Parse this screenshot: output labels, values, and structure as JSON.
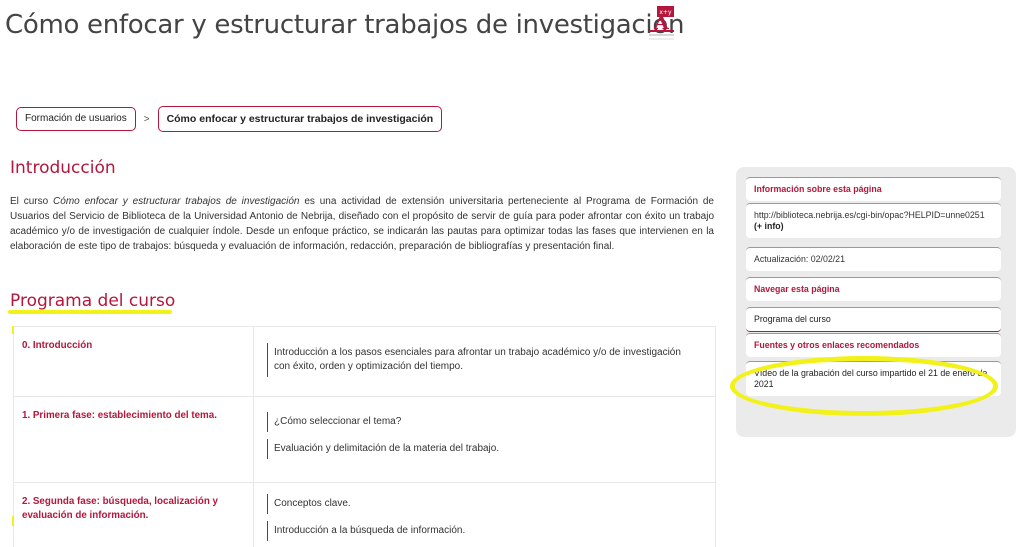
{
  "header": {
    "title": "Cómo enfocar y estructurar trabajos de investigación",
    "logo_icon": "book-formula-icon"
  },
  "breadcrumb": {
    "items": [
      "Formación de usuarios",
      "Cómo enfocar y estructurar trabajos de investigación"
    ],
    "separator": ">"
  },
  "intro": {
    "title": "Introducción",
    "text_before": "El curso ",
    "text_em": "Cómo enfocar y estructurar trabajos de investigación",
    "text_after": " es una actividad de extensión universitaria perteneciente al Programa de Formación de Usuarios del Servicio de Biblioteca de la Universidad Antonio de Nebrija, diseñado con el propósito de servir de guía para poder afrontar con éxito un trabajo académico y/o de investigación de cualquier índole. Desde un enfoque práctico, se indicarán las pautas para optimizar todas las fases que intervienen en la elaboración de este tipo de trabajos: búsqueda y evaluación de información, redacción, preparación de bibliografías y presentación final."
  },
  "program": {
    "title": "Programa del curso",
    "rows": [
      {
        "phase": "0. Introducción",
        "topics": [
          "Introducción a los pasos esenciales para afrontar un trabajo académico y/o de investigación con éxito, orden y optimización del tiempo."
        ]
      },
      {
        "phase": "1. Primera fase: establecimiento del tema.",
        "topics": [
          "¿Cómo seleccionar el tema?",
          "Evaluación y delimitación de la materia del trabajo."
        ]
      },
      {
        "phase": "2. Segunda fase: búsqueda, localización y evaluación de información.",
        "topics": [
          "Conceptos clave.",
          "Introducción a la búsqueda de información."
        ]
      }
    ]
  },
  "sidebar": {
    "info_heading": "Información sobre esta página",
    "url": "http://biblioteca.nebrija.es/cgi-bin/opac?HELPID=unne0251",
    "more_info": "(+ info)",
    "updated": "Actualización: 02/02/21",
    "nav_heading": "Navegar esta página",
    "nav_item": "Programa del curso",
    "sources_heading": "Fuentes y otros enlaces recomendados",
    "video_link": "Vídeo de la grabación del curso impartido el 21 de enero de 2021"
  },
  "colors": {
    "accent": "#b5163c",
    "highlight": "#f2f21a"
  }
}
